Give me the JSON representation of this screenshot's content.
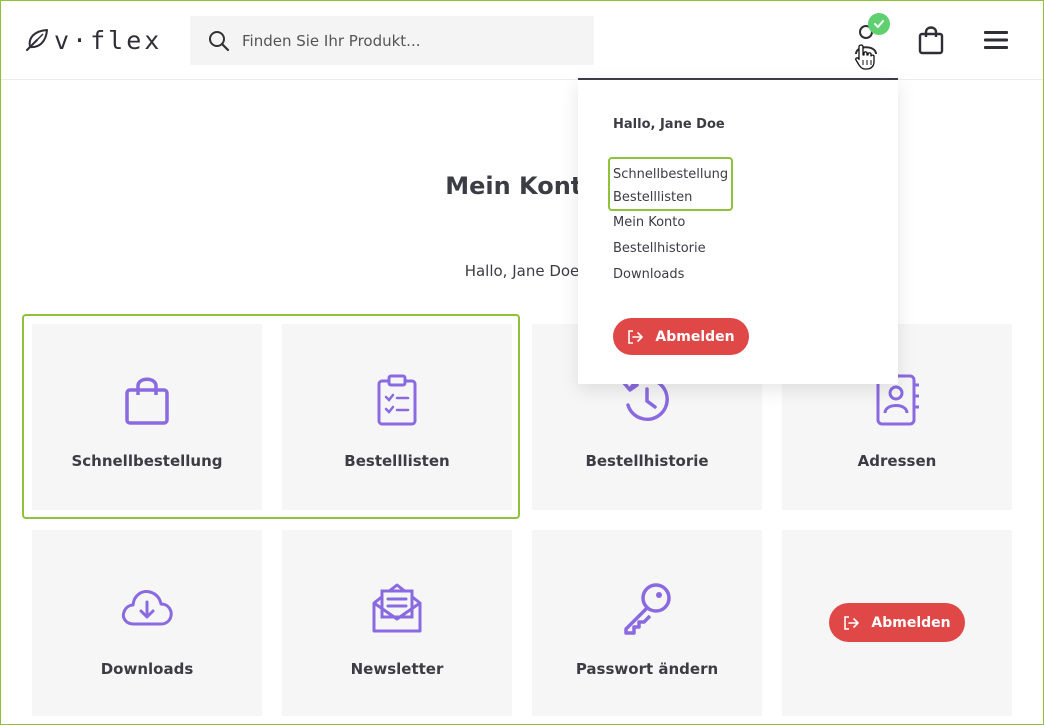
{
  "header": {
    "logo_text": "v·flex",
    "search": {
      "placeholder": "Finden Sie Ihr Produkt..."
    }
  },
  "page": {
    "title": "Mein Konto",
    "greeting": "Hallo, Jane Doe"
  },
  "tiles": [
    {
      "label": "Schnellbestellung",
      "icon": "shopping-bag-icon"
    },
    {
      "label": "Bestelllisten",
      "icon": "clipboard-list-icon"
    },
    {
      "label": "Bestellhistorie",
      "icon": "history-clock-icon"
    },
    {
      "label": "Adressen",
      "icon": "address-book-icon"
    },
    {
      "label": "Downloads",
      "icon": "cloud-download-icon"
    },
    {
      "label": "Newsletter",
      "icon": "envelope-open-icon"
    },
    {
      "label": "Passwort ändern",
      "icon": "key-icon"
    }
  ],
  "logout_label": "Abmelden",
  "dropdown": {
    "hello": "Hallo, Jane Doe",
    "links": [
      "Schnellbestellung",
      "Bestelllisten",
      "Mein Konto",
      "Bestellhistorie",
      "Downloads"
    ],
    "logout_label": "Abmelden"
  },
  "colors": {
    "accent_purple": "#8a6ae0",
    "logout_red": "#e04848",
    "highlight_green": "#8fc23a",
    "check_green": "#5fcf6f"
  }
}
